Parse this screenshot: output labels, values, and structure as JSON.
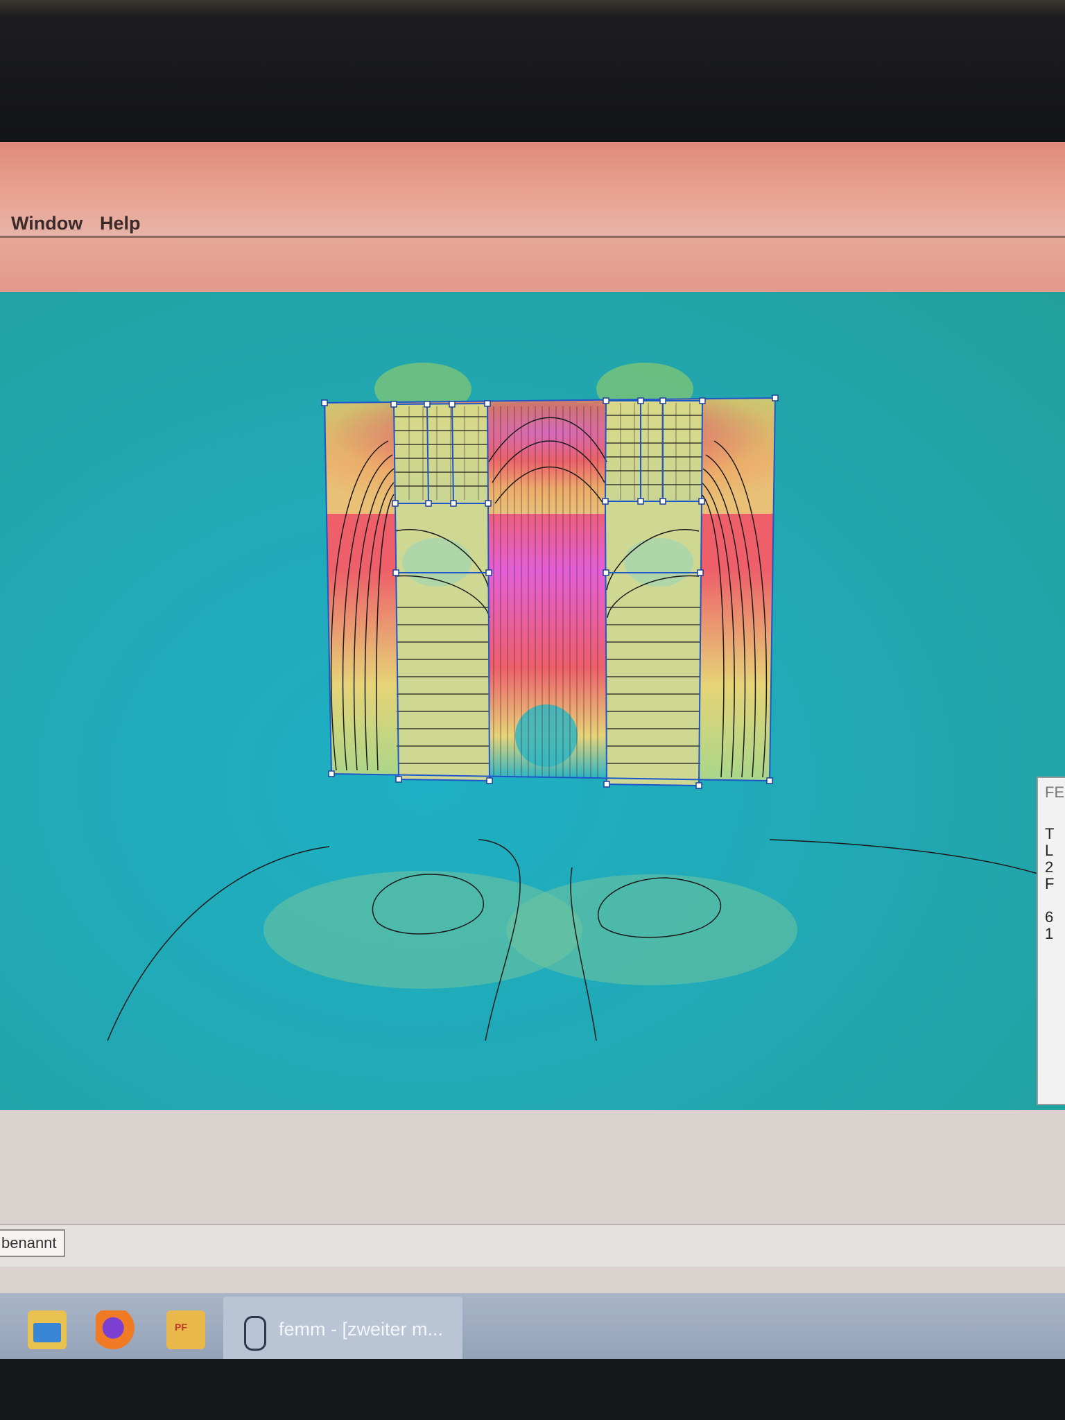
{
  "menu": {
    "items": [
      "Window",
      "Help"
    ]
  },
  "side_panel": {
    "title": "FE",
    "lines": [
      "T",
      "L",
      "2",
      "F",
      "",
      "6",
      "1"
    ]
  },
  "status": {
    "doc_tab": "benannt"
  },
  "taskbar": {
    "active_task_label": "femm - [zweiter m...",
    "pinned": [
      "file-explorer-icon",
      "firefox-icon",
      "pdf-reader-icon",
      "femm-icon"
    ]
  },
  "colors": {
    "low_field": "#1eb0c4",
    "medium_field": "#e6e27a",
    "high_field": "#ee5f6a",
    "peak_field": "#e45fd7",
    "geometry_lines": "#1f56c9",
    "contours": "#1a1a1a"
  }
}
